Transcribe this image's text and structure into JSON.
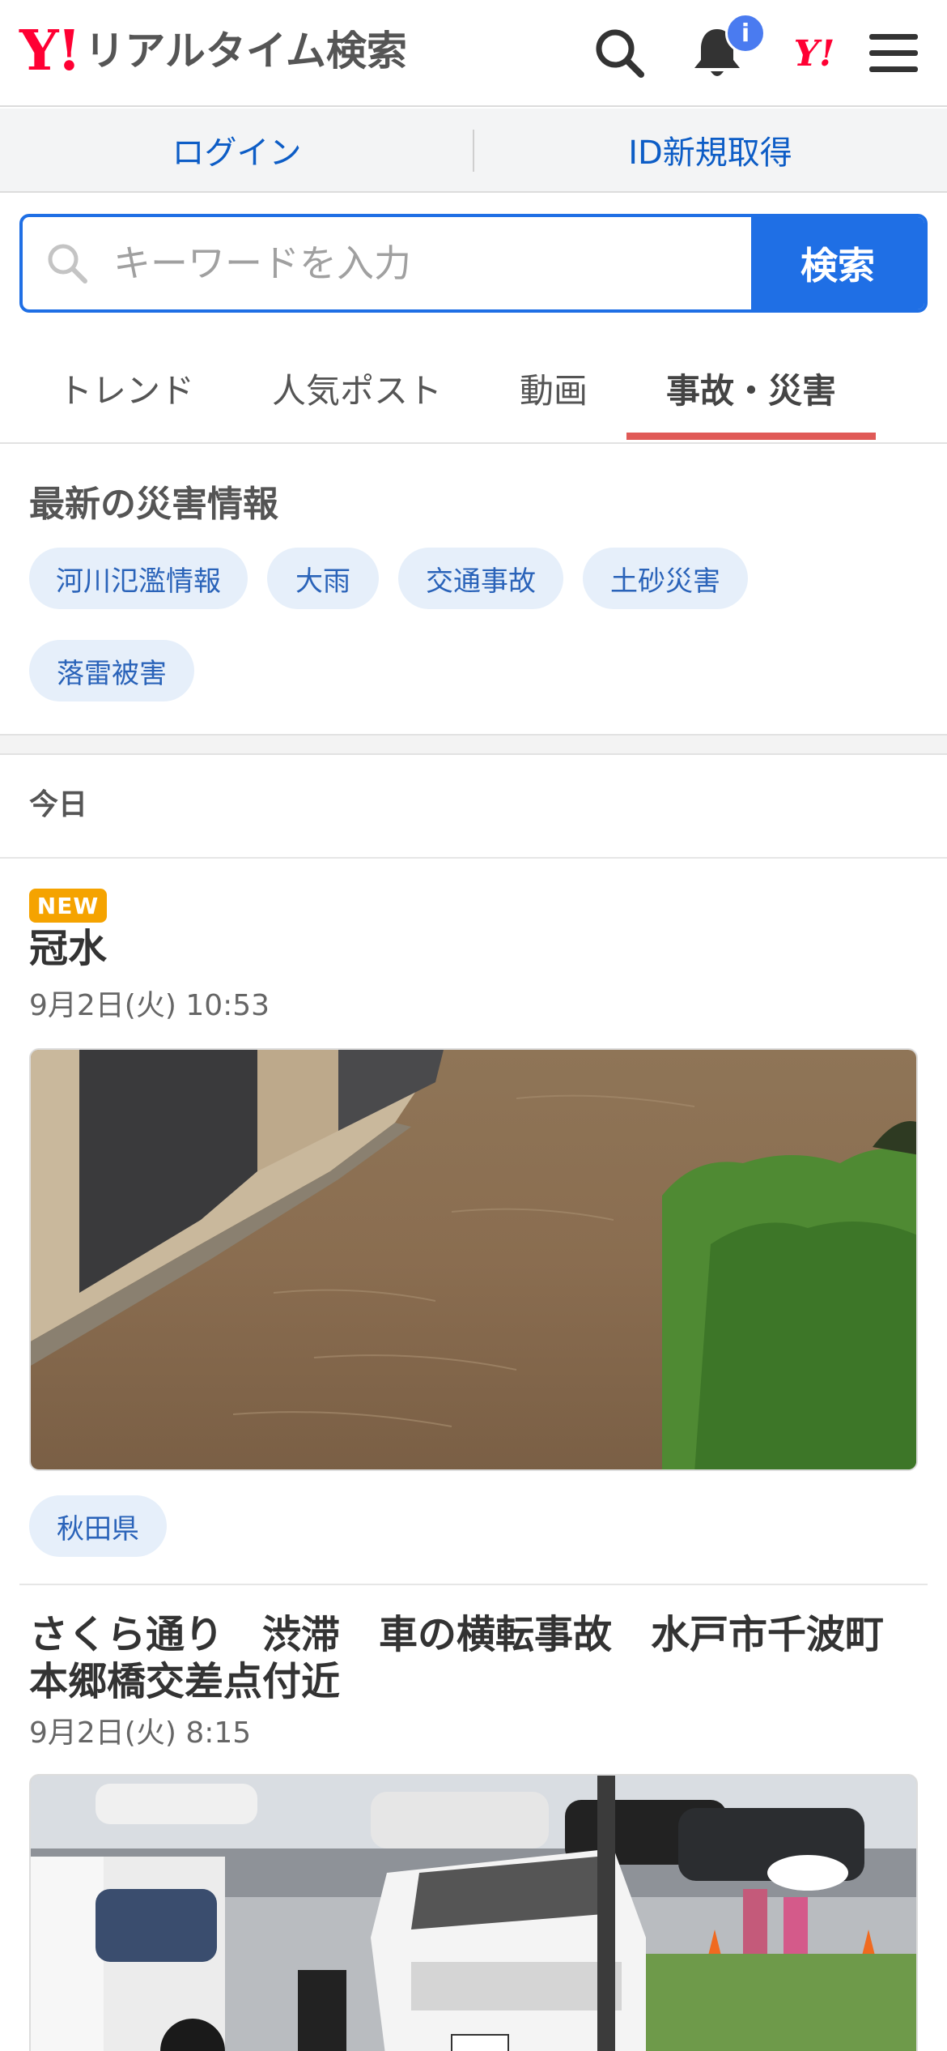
{
  "header": {
    "logo_mark": "Y!",
    "logo_text": "リアルタイム検索",
    "notification_badge": "i",
    "yahoo_mark": "Y!"
  },
  "login_bar": {
    "login": "ログイン",
    "register": "ID新規取得"
  },
  "search": {
    "placeholder": "キーワードを入力",
    "button": "検索"
  },
  "tabs": [
    {
      "label": "トレンド"
    },
    {
      "label": "人気ポスト"
    },
    {
      "label": "動画"
    },
    {
      "label": "事故・災害",
      "active": true
    }
  ],
  "disaster": {
    "title": "最新の災害情報",
    "chips": [
      "河川氾濫情報",
      "大雨",
      "交通事故",
      "土砂災害",
      "落雷被害"
    ]
  },
  "feed": {
    "day_label": "今日",
    "posts": [
      {
        "badge": "NEW",
        "title": "冠水",
        "date": "9月2日(火) 10:53",
        "tag": "秋田県"
      },
      {
        "title_line1": "さくら通り　渋滞　車の横転事故　水戸市千波町",
        "title_line2": "本郷橋交差点付近",
        "date": "9月2日(火) 8:15"
      }
    ]
  },
  "colors": {
    "accent": "#1f6fe5",
    "brand": "#ff0033",
    "tab_underline": "#e05a57",
    "new_badge": "#f5a300",
    "chip_bg": "#e6effa"
  }
}
